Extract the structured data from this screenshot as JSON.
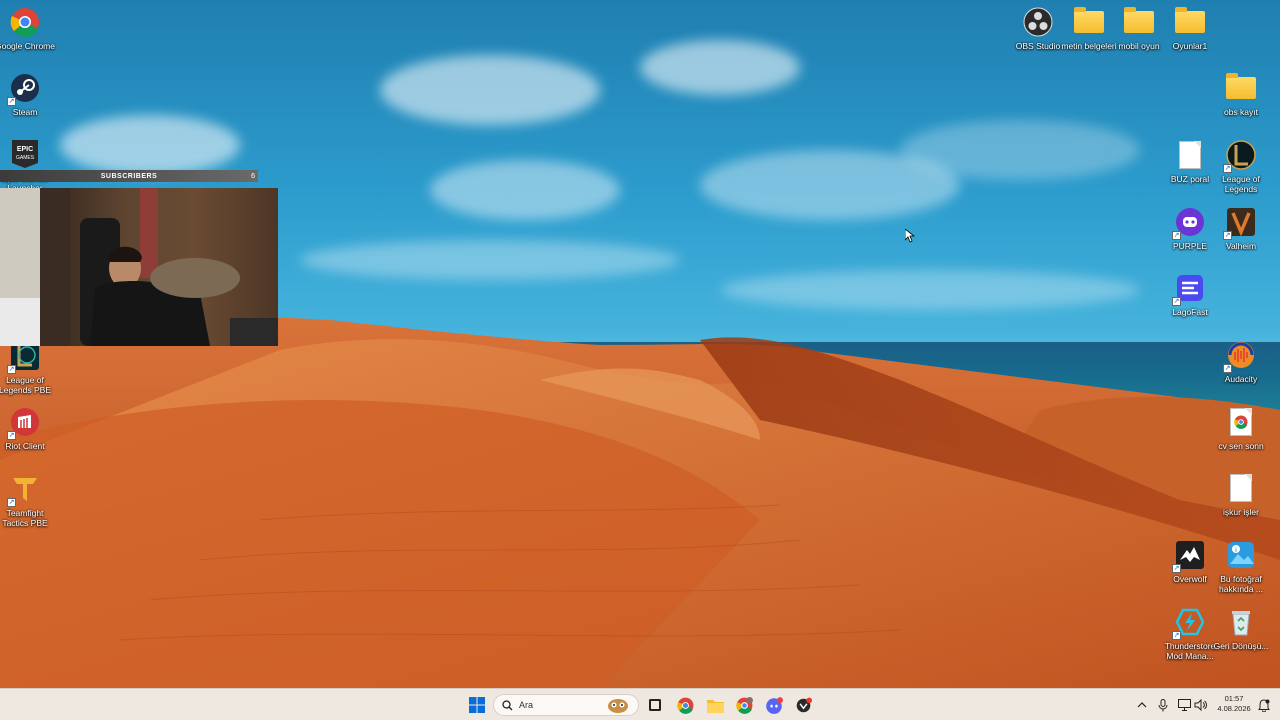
{
  "desktop": {
    "left_icons": [
      {
        "label": "Google Chrome",
        "icon": "chrome-icon"
      },
      {
        "label": "Steam",
        "icon": "steam-icon"
      },
      {
        "label": "Epic Games Launcher",
        "icon": "epic-games-icon"
      },
      {
        "label": "League of Legends PBE",
        "icon": "league-pbe-icon"
      },
      {
        "label": "Riot Client",
        "icon": "riot-client-icon"
      },
      {
        "label": "Teamfight Tactics PBE",
        "icon": "tft-pbe-icon"
      }
    ],
    "top_icons": [
      {
        "label": "OBS Studio",
        "icon": "obs-icon"
      },
      {
        "label": "metin belgeleri",
        "icon": "folder-icon"
      },
      {
        "label": "mobil oyun",
        "icon": "folder-icon"
      },
      {
        "label": "Oyunlar1",
        "icon": "folder-icon"
      }
    ],
    "right_icons": [
      {
        "label": "obs kayıt",
        "icon": "folder-icon"
      },
      {
        "label": "BUZ poral",
        "icon": "document-icon"
      },
      {
        "label": "League of Legends",
        "icon": "league-icon"
      },
      {
        "label": "PURPLE",
        "icon": "purple-icon"
      },
      {
        "label": "Valheim",
        "icon": "valheim-icon"
      },
      {
        "label": "LagoFast",
        "icon": "lagofast-icon"
      },
      {
        "label": "Audacity",
        "icon": "audacity-icon"
      },
      {
        "label": "cv sen sonn",
        "icon": "chrome-doc-icon"
      },
      {
        "label": "işkur işler",
        "icon": "document-icon"
      },
      {
        "label": "Overwolf",
        "icon": "overwolf-icon"
      },
      {
        "label": "Bu fotoğraf hakkında ...",
        "icon": "photo-info-icon"
      },
      {
        "label": "Thunderstore Mod Mana...",
        "icon": "thunderstore-icon"
      },
      {
        "label": "Geri Dönüşü...",
        "icon": "recycle-bin-icon"
      }
    ]
  },
  "overlay": {
    "subscribers_title": "SUBSCRIBERS",
    "subscribers_count": "6"
  },
  "taskbar": {
    "search_placeholder": "Ara",
    "time": "01:57",
    "date": "4.08.2026",
    "apps": [
      "start-icon",
      "search-icon",
      "task-view-icon",
      "chrome-icon",
      "file-explorer-icon",
      "chrome-profile-icon",
      "discord-icon",
      "app-icon"
    ]
  },
  "colors": {
    "taskbar_bg": "#efe8e0",
    "sky": "#2c9ccd",
    "sand": "#c2541f",
    "sea": "#17688d"
  }
}
